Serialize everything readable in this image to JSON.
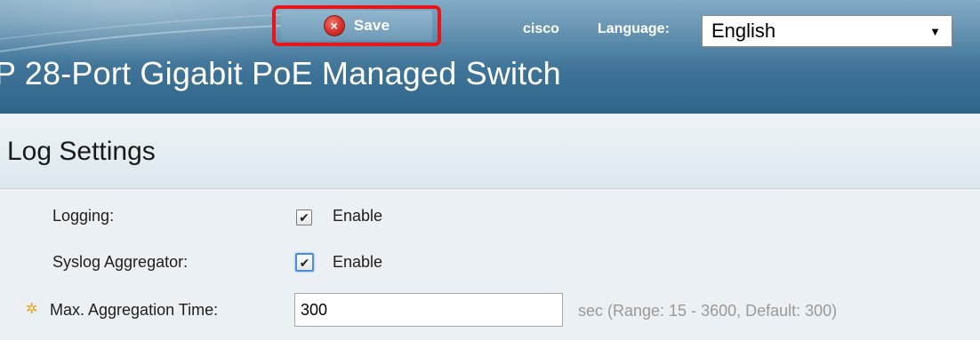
{
  "header": {
    "save_label": "Save",
    "brand": "cisco",
    "language_label": "Language:",
    "language_value": "English",
    "product_title": "P 28-Port Gigabit PoE Managed Switch"
  },
  "page": {
    "title": "Log Settings"
  },
  "form": {
    "logging": {
      "label": "Logging:",
      "option": "Enable",
      "checked": true
    },
    "syslog_aggregator": {
      "label": "Syslog Aggregator:",
      "option": "Enable",
      "checked": true
    },
    "max_aggregation_time": {
      "label": "Max. Aggregation Time:",
      "value": "300",
      "hint": "sec (Range: 15 - 3600, Default: 300)"
    }
  },
  "colors": {
    "highlight": "#e8161b",
    "header_dark": "#2e6588",
    "required_icon": "#e8a317"
  }
}
